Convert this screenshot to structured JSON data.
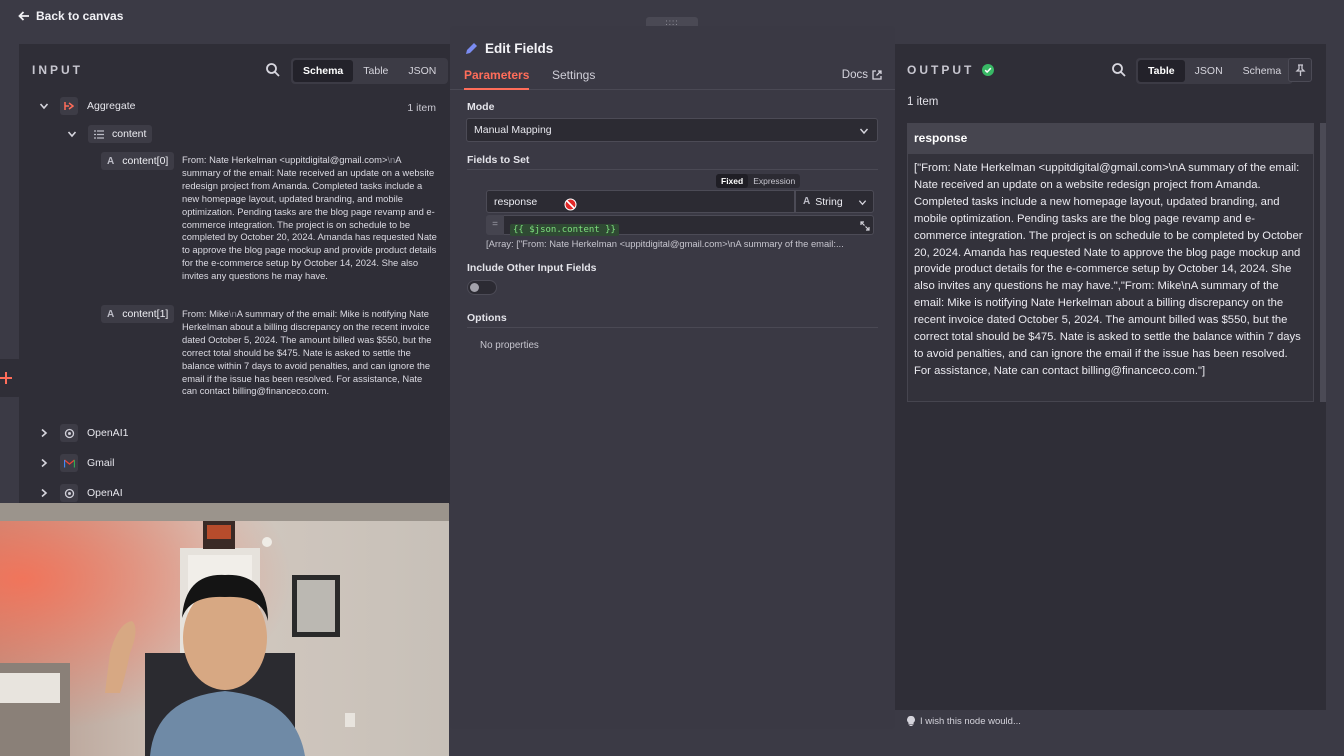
{
  "nav": {
    "back_label": "Back to canvas"
  },
  "input": {
    "title": "INPUT",
    "view_tabs": [
      "Schema",
      "Table",
      "JSON"
    ],
    "active_view": "Schema",
    "root_node": "Aggregate",
    "root_count": "1 item",
    "array_field": "content",
    "fields": [
      {
        "key": "content[0]",
        "type": "A",
        "value_before": "From: Nate Herkelman <uppitdigital@gmail.com>",
        "value_esc": "\\n",
        "value_after": "A summary of the email: Nate received an update on a website redesign project from Amanda. Completed tasks include a new homepage layout, updated branding, and mobile optimization. Pending tasks are the blog page revamp and e-commerce integration. The project is on schedule to be completed by October 20, 2024. Amanda has requested Nate to approve the blog page mockup and provide product details for the e-commerce setup by October 14, 2024. She also invites any questions he may have."
      },
      {
        "key": "content[1]",
        "type": "A",
        "value_before": "From: Mike",
        "value_esc": "\\n",
        "value_after": "A summary of the email: Mike is notifying Nate Herkelman about a billing discrepancy on the recent invoice dated October 5, 2024. The amount billed was $550, but the correct total should be $475. Nate is asked to settle the balance within 7 days to avoid penalties, and can ignore the email if the issue has been resolved. For assistance, Nate can contact billing@financeco.com."
      }
    ],
    "other_nodes": [
      "OpenAI1",
      "Gmail",
      "OpenAI"
    ]
  },
  "edit": {
    "handle": "::::",
    "title": "Edit Fields",
    "tabs": [
      "Parameters",
      "Settings"
    ],
    "active_tab": "Parameters",
    "docs_label": "Docs",
    "mode_label": "Mode",
    "mode_value": "Manual Mapping",
    "fields_to_set_label": "Fields to Set",
    "fixed_label": "Fixed",
    "expression_label": "Expression",
    "field_name": "response",
    "field_type_icon": "A",
    "field_type": "String",
    "eq_symbol": "=",
    "expression": "{{ $json.content }}",
    "preview": "[Array: [\"From: Nate Herkelman <uppitdigital@gmail.com>\\nA summary of the email:...",
    "include_other_label": "Include Other Input Fields",
    "include_other_enabled": false,
    "options_label": "Options",
    "no_properties": "No properties"
  },
  "output": {
    "title": "OUTPUT",
    "view_tabs": [
      "Table",
      "JSON",
      "Schema"
    ],
    "active_view": "Table",
    "items_count": "1 item",
    "column": "response",
    "cell": "[\"From: Nate Herkelman <uppitdigital@gmail.com>\\nA summary of the email: Nate received an update on a website redesign project from Amanda. Completed tasks include a new homepage layout, updated branding, and mobile optimization. Pending tasks are the blog page revamp and e-commerce integration. The project is on schedule to be completed by October 20, 2024. Amanda has requested Nate to approve the blog page mockup and provide product details for the e-commerce setup by October 14, 2024. She also invites any questions he may have.\",\"From: Mike\\nA summary of the email: Mike is notifying Nate Herkelman about a billing discrepancy on the recent invoice dated October 5, 2024. The amount billed was $550, but the correct total should be $475. Nate is asked to settle the balance within 7 days to avoid penalties, and can ignore the email if the issue has been resolved. For assistance, Nate can contact billing@financeco.com.\"]",
    "wish_label": "I wish this node would..."
  },
  "colors": {
    "accent": "#ff6d5a",
    "success": "#38b865",
    "panel": "#2f2e37",
    "background": "#3b3a45"
  }
}
